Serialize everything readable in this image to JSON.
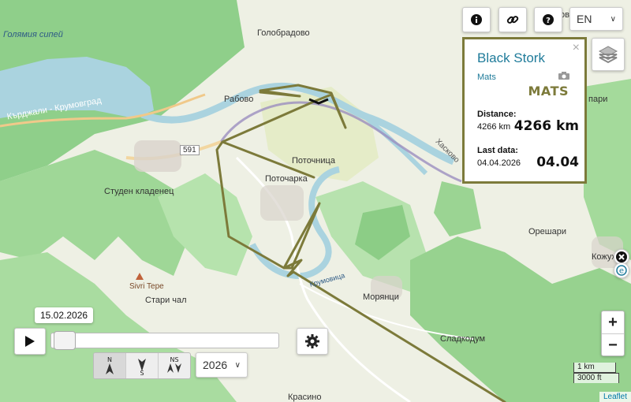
{
  "map": {
    "places": {
      "golemia_sipei": "Голямия сипей",
      "kardzhali_krumovgrad": "Кърджали - Крумовград",
      "golobradovo": "Голобрадово",
      "rabovo": "Рабово",
      "road_591": "591",
      "potochnitsa": "Поточница",
      "potocharka": "Поточарка",
      "studen_kladenets": "Студен кладенец",
      "sivri_tepe": "Sivri Tepe",
      "stari_chal": "Стари чал",
      "moryantsi": "Морянци",
      "oreshari": "Орешари",
      "sladkodum": "Сладкодум",
      "kozhuh": "Кожух",
      "haskovo": "Хасково",
      "krumovitsa": "Крумовица",
      "krasino": "Красино",
      "pari": "пари",
      "ov": "ов"
    }
  },
  "toolbar": {
    "language": "EN",
    "info_icon": "info-icon",
    "link_icon": "link-icon",
    "help_icon": "help-icon",
    "layers_icon": "layers-icon"
  },
  "popup": {
    "title": "Black Stork",
    "subtitle": "Mats",
    "bird_name": "MATS",
    "distance_label": "Distance:",
    "distance_small": "4266 km",
    "distance_big": "4266 km",
    "last_data_label": "Last data:",
    "last_data_small": "04.04.2026",
    "last_data_big": "04.04",
    "close": "×",
    "accent_color": "#7c7a3a"
  },
  "timeline": {
    "date": "15.02.2026",
    "year": "2026",
    "play_icon": "play-icon",
    "settings_icon": "gear-icon",
    "dir_buttons": [
      "N",
      "S",
      "NS"
    ]
  },
  "zoom": {
    "in": "+",
    "out": "−"
  },
  "scale": {
    "metric": "1 km",
    "imperial": "3000 ft"
  },
  "attribution": "Leaflet",
  "track_color": "#7c7a3a"
}
